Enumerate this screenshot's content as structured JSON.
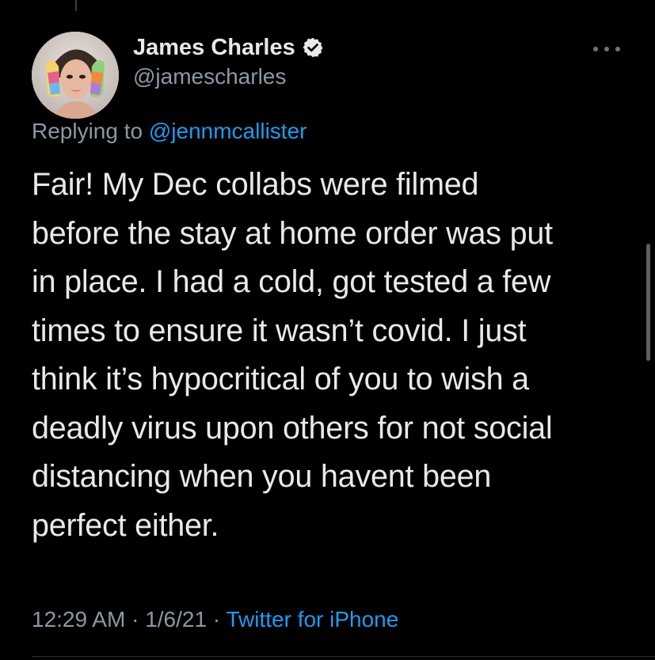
{
  "tweet": {
    "author": {
      "display_name": "James Charles",
      "handle": "@jamescharles",
      "verified": true
    },
    "reply": {
      "prefix": "Replying to ",
      "mention": "@jennmcallister"
    },
    "text_lines": [
      "Fair! My Dec collabs were filmed",
      "before the stay at home order was put",
      "in place. I had a cold, got tested a few",
      "times to ensure it wasn’t covid. I just",
      "think it’s hypocritical of you to wish a",
      "deadly virus upon others for not social",
      "distancing when you havent been",
      "perfect either."
    ],
    "meta": {
      "time": "12:29 AM",
      "separator": " · ",
      "date": "1/6/21",
      "source": "Twitter for iPhone"
    }
  },
  "icons": {
    "verified": "verified-badge-icon",
    "more": "more-options-icon"
  },
  "colors": {
    "background": "#000000",
    "text_primary": "#e7e9ea",
    "text_secondary": "#8b98a5",
    "link_blue": "#1d9bf0"
  }
}
